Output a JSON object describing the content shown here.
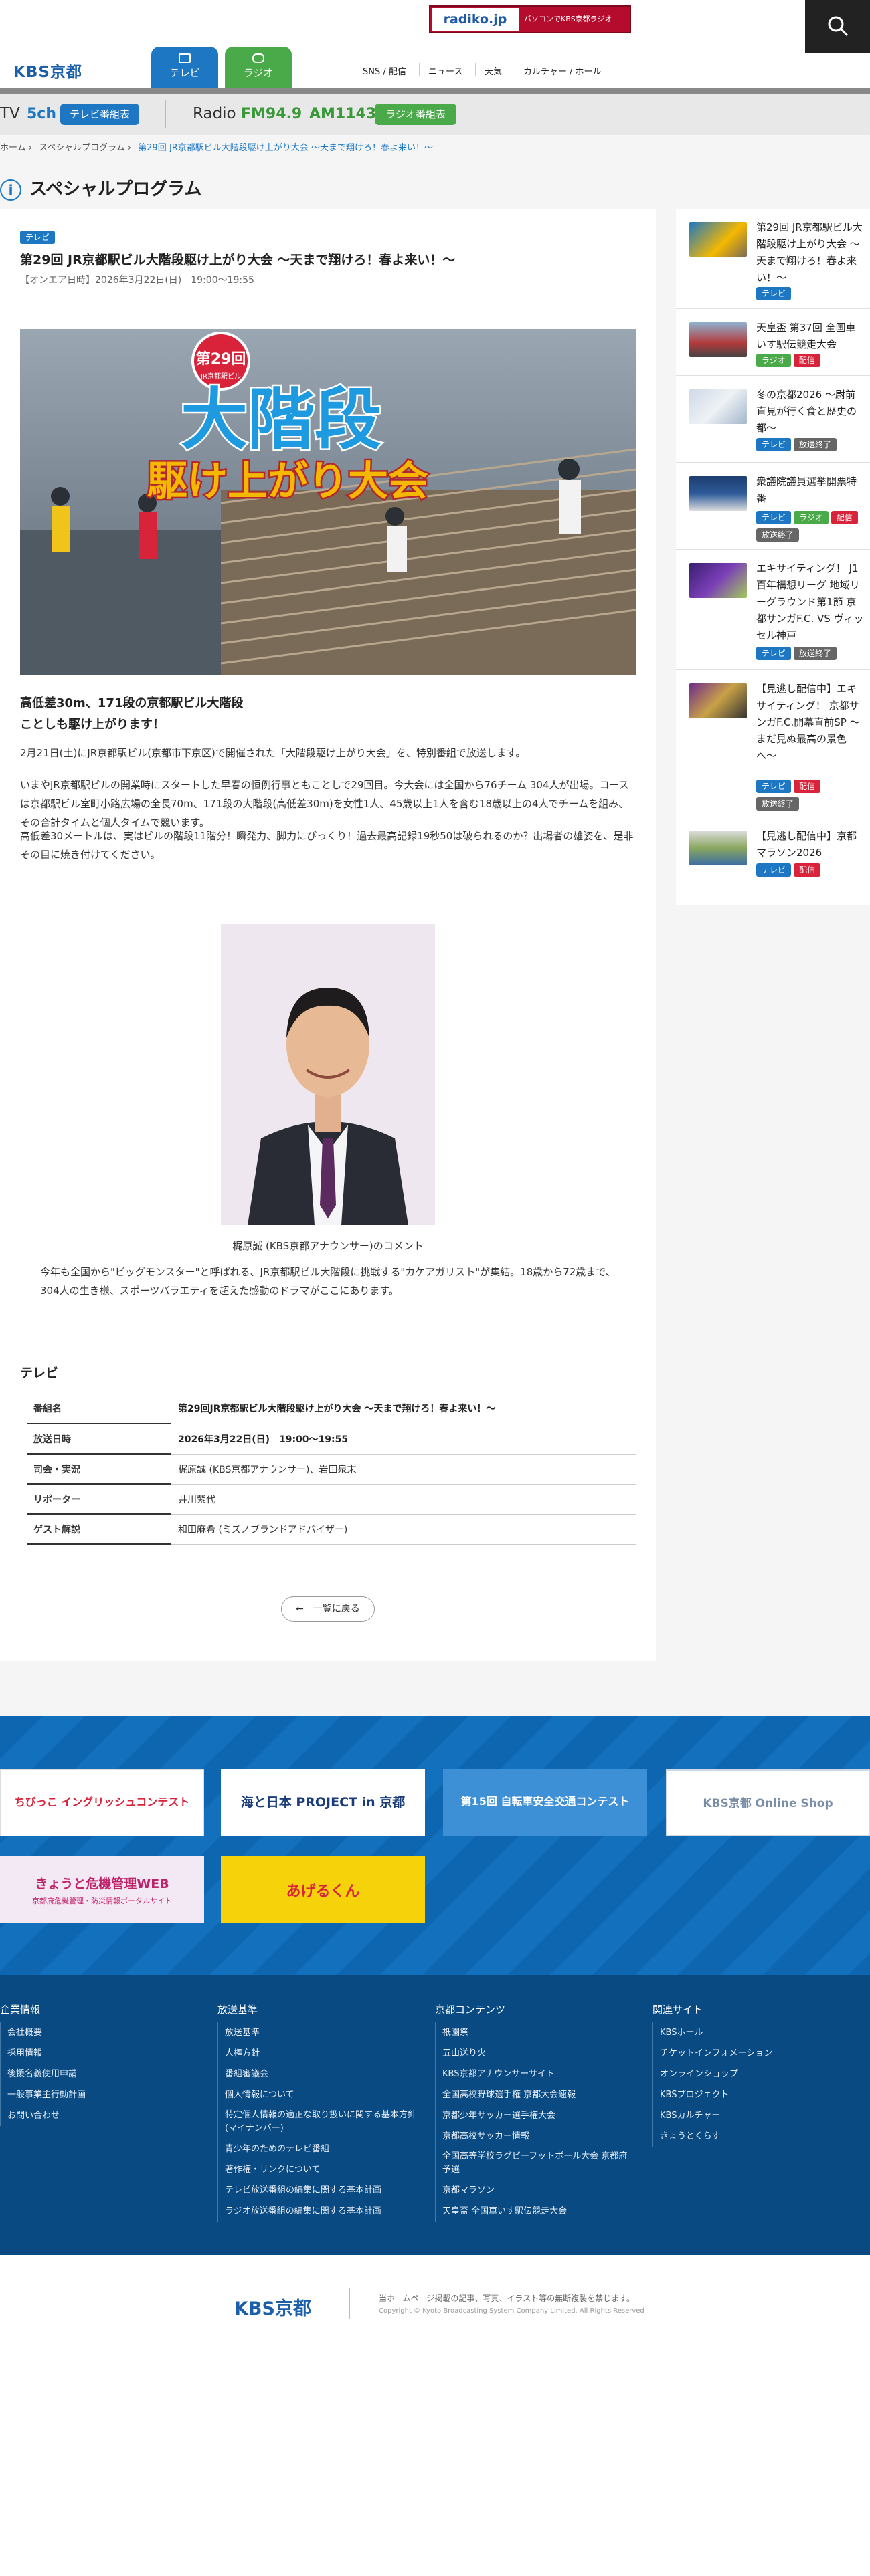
{
  "header": {
    "radiko_logo": "radiko.jp",
    "radiko_text": "パソコンでKBS京都ラジオ",
    "site_logo": "KBS京都",
    "tabs": [
      {
        "label": "テレビ"
      },
      {
        "label": "ラジオ"
      }
    ],
    "nav": [
      "SNS / 配信",
      "ニュース",
      "天気",
      "カルチャー / ホール"
    ]
  },
  "channel_bar": {
    "tv_label": "TV",
    "tv_ch": "5ch",
    "tv_guide": "テレビ番組表",
    "radio_label": "Radio",
    "fm": "FM94.9",
    "am": "AM1143",
    "radio_guide": "ラジオ番組表"
  },
  "breadcrumb": [
    "ホーム",
    "スペシャルプログラム",
    "第29回 JR京都駅ビル大階段駆け上がり大会 〜天まで翔けろ！春よ来い！〜"
  ],
  "page_title": "スペシャルプログラム",
  "article": {
    "badge": "テレビ",
    "title": "第29回 JR京都駅ビル大階段駆け上がり大会 〜天まで翔けろ！春よ来い！〜",
    "date": "【オンエア日時】2026年3月22日(日)　19:00〜19:55",
    "hero": {
      "edition": "第29回",
      "edition_sub": "JR京都駅ビル",
      "title_main": "大階段",
      "title_sub": "駆け上がり大会"
    },
    "lead_line1": "高低差30m、171段の京都駅ビル大階段",
    "lead_line2": "ことしも駆け上がります！",
    "para1": "2月21日(土)にJR京都駅ビル(京都市下京区)で開催された「大階段駆け上がり大会」を、特別番組で放送します。",
    "para2": "いまやJR京都駅ビルの開業時にスタートした早春の恒例行事ともことしで29回目。今大会には全国から76チーム 304人が出場。コースは京都駅ビル室町小路広場の全長70m、171段の大階段(高低差30m)を女性1人、45歳以上1人を含む18歳以上の4人でチームを組み、その合計タイムと個人タイムで競います。",
    "para3": "高低差30メートルは、実はビルの階段11階分！瞬発力、脚力にびっくり！過去最高記録19秒50は破られるのか？出場者の雄姿を、是非その目に焼き付けてください。",
    "photo_caption": "梶原誠 (KBS京都アナウンサー)のコメント",
    "comment": "今年も全国から\"ビッグモンスター\"と呼ばれる、JR京都駅ビル大階段に挑戦する\"カケアガリスト\"が集結。18歳から72歳まで、304人の生き様、スポーツバラエティを超えた感動のドラマがここにあります。",
    "section_heading": "テレビ",
    "info": [
      {
        "k": "番組名",
        "v": "第29回JR京都駅ビル大階段駆け上がり大会 〜天まで翔けろ！春よ来い！〜",
        "bold": true
      },
      {
        "k": "放送日時",
        "v": "2026年3月22日(日)　19:00〜19:55",
        "bold": true
      },
      {
        "k": "司会・実況",
        "v": "梶原誠 (KBS京都アナウンサー)、岩田泉末",
        "bold": false
      },
      {
        "k": "リポーター",
        "v": "井川紫代",
        "bold": false
      },
      {
        "k": "ゲスト解説",
        "v": "和田麻希 (ミズノブランドアドバイザー)",
        "bold": false
      }
    ],
    "back_label": "一覧に戻る"
  },
  "sidebar": [
    {
      "title": "第29回 JR京都駅ビル大階段駆け上がり大会 〜天まで翔けろ！春よ来い！〜",
      "badges": [
        {
          "t": "テレビ",
          "c": "tv"
        }
      ]
    },
    {
      "title": "天皇盃 第37回 全国車いす駅伝競走大会",
      "badges": [
        {
          "t": "ラジオ",
          "c": "radio"
        },
        {
          "t": "配信",
          "c": "live"
        }
      ]
    },
    {
      "title": "冬の京都2026 〜尉前直見が行く食と歴史の都〜",
      "badges": [
        {
          "t": "テレビ",
          "c": "tv"
        },
        {
          "t": "放送終了",
          "c": "done"
        }
      ]
    },
    {
      "title": "衆議院議員選挙開票特番",
      "badges": [
        {
          "t": "テレビ",
          "c": "tv"
        },
        {
          "t": "ラジオ",
          "c": "radio"
        },
        {
          "t": "配信",
          "c": "live"
        },
        {
          "t": "放送終了",
          "c": "done"
        }
      ]
    },
    {
      "title": "エキサイティング！ J1百年構想リーグ 地域リーグラウンド第1節 京都サンガF.C. VS ヴィッセル神戸",
      "badges": [
        {
          "t": "テレビ",
          "c": "tv"
        },
        {
          "t": "放送終了",
          "c": "done"
        }
      ]
    },
    {
      "title": "【見逃し配信中】エキサイティング！ 京都サンガF.C.開幕直前SP 〜まだ見ぬ最高の景色へ〜",
      "badges": [
        {
          "t": "テレビ",
          "c": "tv"
        },
        {
          "t": "配信",
          "c": "live"
        },
        {
          "t": "放送終了",
          "c": "done"
        }
      ]
    },
    {
      "title": "【見逃し配信中】京都マラソン2026",
      "badges": [
        {
          "t": "テレビ",
          "c": "tv"
        },
        {
          "t": "配信",
          "c": "live"
        }
      ]
    }
  ],
  "banners": [
    {
      "label": "ちびっこ イングリッシュコンテスト"
    },
    {
      "label": "海と日本 PROJECT in 京都"
    },
    {
      "label": "第15回 自転車安全交通コンテスト"
    },
    {
      "label": "KBS京都 Online Shop"
    },
    {
      "label": "きょうと危機管理WEB"
    },
    {
      "label": "あげるくん"
    }
  ],
  "banner_sub": "京都府危機管理・防災情報ポータルサイト",
  "footer": {
    "cols": [
      {
        "h": "企業情報",
        "items": [
          "会社概要",
          "採用情報",
          "後援名義使用申請",
          "一般事業主行動計画",
          "お問い合わせ"
        ]
      },
      {
        "h": "放送基準",
        "items": [
          "放送基準",
          "人権方針",
          "番組審議会",
          "個人情報について",
          "特定個人情報の適正な取り扱いに関する基本方針(マイナンバー)",
          "青少年のためのテレビ番組",
          "著作権・リンクについて",
          "テレビ放送番組の編集に関する基本計画",
          "ラジオ放送番組の編集に関する基本計画"
        ]
      },
      {
        "h": "京都コンテンツ",
        "items": [
          "祇園祭",
          "五山送り火",
          "KBS京都アナウンサーサイト",
          "全国高校野球選手権 京都大会速報",
          "京都少年サッカー選手権大会",
          "京都高校サッカー情報",
          "全国高等学校ラグビーフットボール大会 京都府予選",
          "京都マラソン",
          "天皇盃 全国車いす駅伝競走大会"
        ]
      },
      {
        "h": "関連サイト",
        "items": [
          "KBSホール",
          "チケットインフォメーション",
          "オンラインショップ",
          "KBSプロジェクト",
          "KBSカルチャー",
          "きょうとくらす"
        ]
      }
    ],
    "logo": "KBS京都",
    "note": "当ホームページ掲載の記事、写真、イラスト等の無断複製を禁じます。",
    "copyright": "Copyright © Kyoto Broadcasting System Company Limited. All Rights Reserved"
  }
}
